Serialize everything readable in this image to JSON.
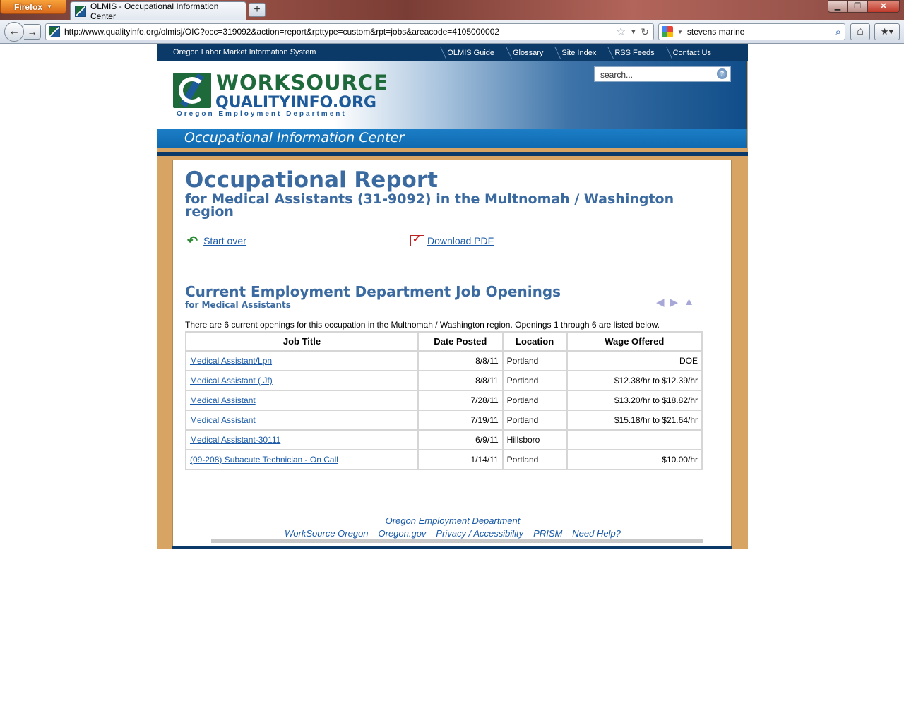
{
  "browser": {
    "menu_button": "Firefox",
    "tab_title": "OLMIS - Occupational Information Center",
    "url": "http://www.qualityinfo.org/olmisj/OIC?occ=319092&action=report&rpttype=custom&rpt=jobs&areacode=4105000002",
    "search_value": "stevens marine"
  },
  "site": {
    "topnav_title": "Oregon Labor Market Information System",
    "topnav_links": [
      "OLMIS Guide",
      "Glossary",
      "Site Index",
      "RSS Feeds",
      "Contact Us"
    ],
    "logo_line1": "WORKSOURCE",
    "logo_line2": "QUALITYINFO.ORG",
    "logo_line3": "Oregon Employment Department",
    "search_placeholder": "search...",
    "banner": "Occupational Information Center"
  },
  "report": {
    "title": "Occupational Report",
    "subtitle": "for Medical Assistants (31-9092) in the Multnomah / Washington region",
    "start_over": "Start over",
    "download_pdf": "Download PDF"
  },
  "jobs": {
    "title": "Current Employment Department Job Openings",
    "subtitle": "for Medical Assistants",
    "summary": "There are 6 current openings for this occupation in the Multnomah / Washington region. Openings 1 through 6 are listed below.",
    "columns": [
      "Job Title",
      "Date Posted",
      "Location",
      "Wage Offered"
    ],
    "rows": [
      {
        "title": "Medical Assistant/Lpn",
        "date": "8/8/11",
        "location": "Portland",
        "wage": "DOE"
      },
      {
        "title": "Medical Assistant ( Jf)",
        "date": "8/8/11",
        "location": "Portland",
        "wage": "$12.38/hr to $12.39/hr"
      },
      {
        "title": "Medical Assistant",
        "date": "7/28/11",
        "location": "Portland",
        "wage": "$13.20/hr to $18.82/hr"
      },
      {
        "title": "Medical Assistant",
        "date": "7/19/11",
        "location": "Portland",
        "wage": "$15.18/hr to $21.64/hr"
      },
      {
        "title": "Medical Assistant-30111",
        "date": "6/9/11",
        "location": "Hillsboro",
        "wage": ""
      },
      {
        "title": "(09-208) Subacute Technician - On Call",
        "date": "1/14/11",
        "location": "Portland",
        "wage": "$10.00/hr"
      }
    ]
  },
  "footer": {
    "line1": "Oregon Employment Department",
    "links": [
      "WorkSource Oregon",
      "Oregon.gov",
      "Privacy / Accessibility",
      "PRISM",
      "Need Help?"
    ]
  }
}
